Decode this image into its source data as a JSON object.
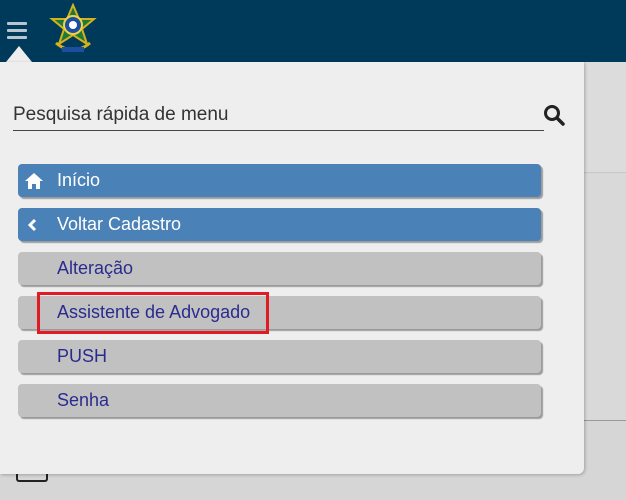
{
  "header": {
    "menu_icon": "hamburger-icon",
    "logo_icon": "coat-of-arms-logo"
  },
  "search": {
    "placeholder": "Pesquisa rápida de menu",
    "icon": "search-icon"
  },
  "menu": {
    "items": [
      {
        "label": "Início",
        "style": "primary",
        "icon": "home-icon"
      },
      {
        "label": "Voltar Cadastro",
        "style": "primary",
        "icon": "chevron-left-icon"
      },
      {
        "label": "Alteração",
        "style": "secondary"
      },
      {
        "label": "Assistente de Advogado",
        "style": "secondary",
        "highlighted": true
      },
      {
        "label": "PUSH",
        "style": "secondary"
      },
      {
        "label": "Senha",
        "style": "secondary"
      }
    ]
  },
  "colors": {
    "topbar": "#003a5a",
    "primary_button": "#4a82b8",
    "secondary_button": "#c1c1c1",
    "secondary_text": "#2b2b8f",
    "highlight": "#e01b24"
  }
}
